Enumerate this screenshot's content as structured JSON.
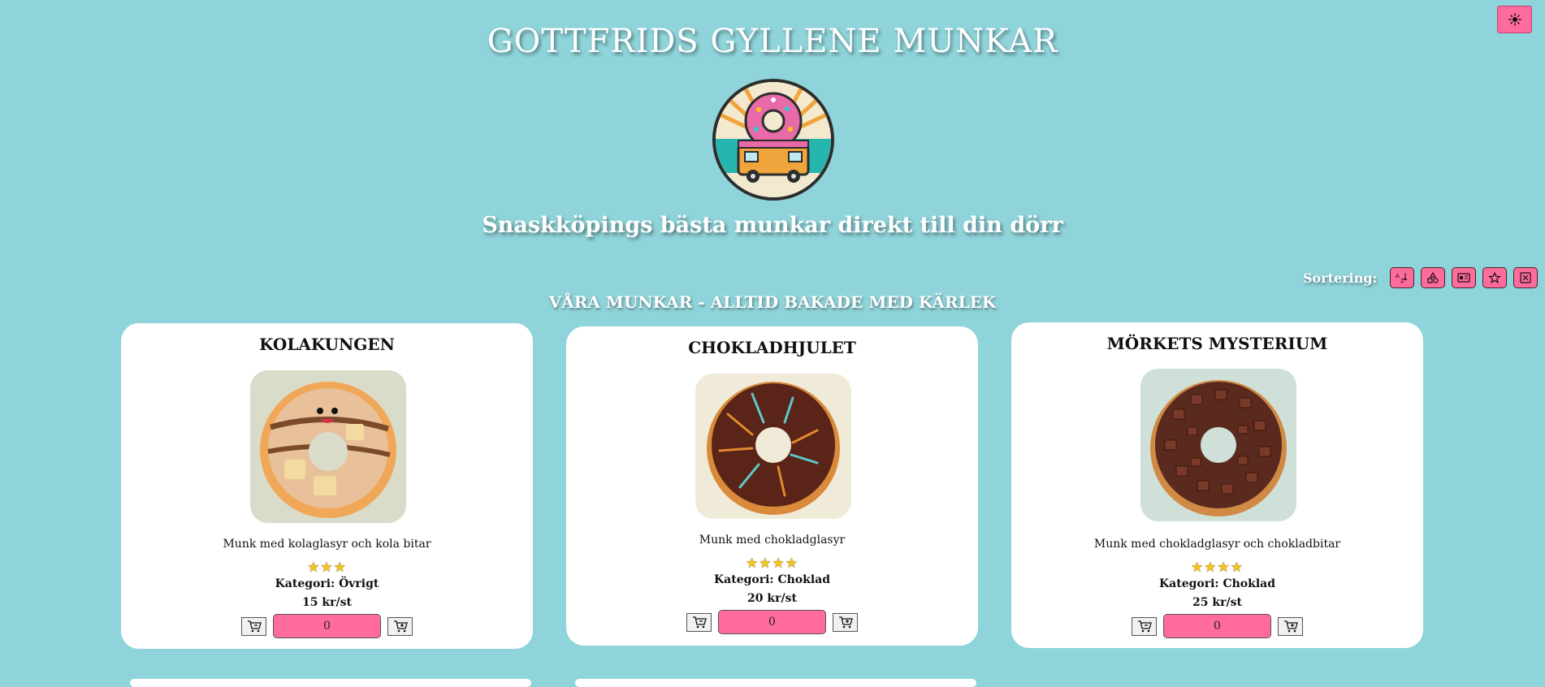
{
  "header": {
    "title": "GOTTFRIDS GYLLENE MUNKAR",
    "tagline": "Snaskköpings bästa munkar direkt till din dörr",
    "theme_icon": "sun-icon",
    "logo_icon": "donut-truck-logo"
  },
  "sort": {
    "label": "Sortering:",
    "buttons": [
      {
        "icon": "sort-alpha-icon"
      },
      {
        "icon": "category-shapes-icon"
      },
      {
        "icon": "price-tag-icon"
      },
      {
        "icon": "star-icon"
      },
      {
        "icon": "reset-x-icon"
      }
    ]
  },
  "section": {
    "title": "VÅRA MUNKAR - ALLTID BAKADE MED KÄRLEK"
  },
  "products": [
    {
      "name": "KOLAKUNGEN",
      "description": "Munk med kolaglasyr och kola bitar",
      "stars": "★★★",
      "rating": 3,
      "category": "Kategori: Övrigt",
      "price": "15 kr/st",
      "quantity": "0",
      "image_icon": "caramel-donut-image"
    },
    {
      "name": "CHOKLADHJULET",
      "description": "Munk med chokladglasyr",
      "stars": "★★★★",
      "rating": 4,
      "category": "Kategori: Choklad",
      "price": "20 kr/st",
      "quantity": "0",
      "image_icon": "chocolate-donut-image"
    },
    {
      "name": "MÖRKETS MYSTERIUM",
      "description": "Munk med chokladglasyr och chokladbitar",
      "stars": "★★★★",
      "rating": 4,
      "category": "Kategori: Choklad",
      "price": "25 kr/st",
      "quantity": "0",
      "image_icon": "dark-chocolate-donut-image"
    }
  ],
  "colors": {
    "background": "#8fd4da",
    "accent": "#ff6b9d",
    "card": "#ffffff"
  }
}
